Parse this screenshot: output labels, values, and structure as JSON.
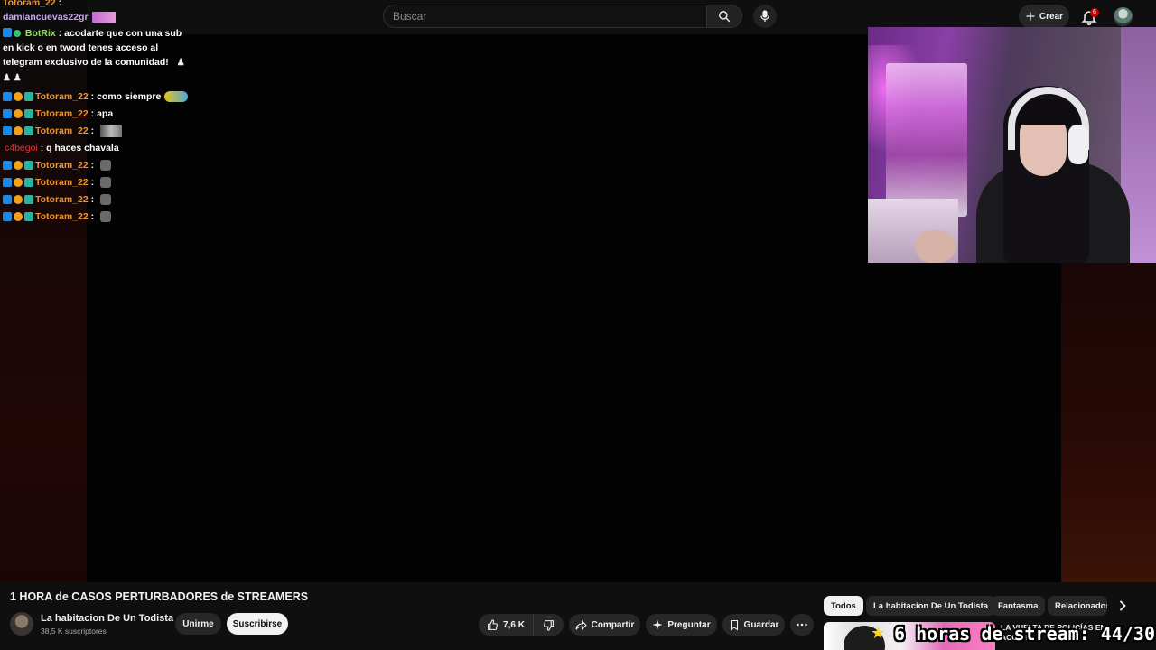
{
  "search": {
    "placeholder": "Buscar"
  },
  "header": {
    "create_label": "Crear",
    "notification_count": "6"
  },
  "chat": {
    "messages": [
      {
        "user": "Totoram_22",
        "text": ""
      },
      {
        "user": "damiancuevas22gr",
        "text": ""
      },
      {
        "user": "BotRix",
        "text": "acodarte que con una sub en kick o en tword tenes acceso al telegram exclusivo de la comunidad!"
      },
      {
        "user": "Totoram_22",
        "text": "como siempre"
      },
      {
        "user": "Totoram_22",
        "text": "apa"
      },
      {
        "user": "Totoram_22",
        "text": ""
      },
      {
        "user": "c4begoi",
        "text": "q haces chavala"
      },
      {
        "user": "Totoram_22",
        "text": ""
      },
      {
        "user": "Totoram_22",
        "text": ""
      },
      {
        "user": "Totoram_22",
        "text": ""
      },
      {
        "user": "Totoram_22",
        "text": ""
      }
    ]
  },
  "video": {
    "title": "1 HORA de CASOS PERTURBADORES de STREAMERS",
    "channel_name": "La habitacion De Un Todista",
    "subscribers": "38,5 K suscriptores",
    "join_label": "Unirme",
    "subscribe_label": "Suscribirse",
    "like_count": "7,6 K",
    "share_label": "Compartir",
    "ask_label": "Preguntar",
    "save_label": "Guardar"
  },
  "chips": [
    "Todos",
    "La habitacion De Un Todista",
    "Fantasma",
    "Relacionados"
  ],
  "related": {
    "title": "LA VUELTA DE POLICÍAS EN ACCIÓN",
    "stream_overlay": "6 horas de stream: 44/30"
  },
  "colors": {
    "accent_red": "#cc0000",
    "chip_active_bg": "#f1f1f1",
    "chat_toto": "#f0932b",
    "chat_bot": "#8fe55d"
  }
}
